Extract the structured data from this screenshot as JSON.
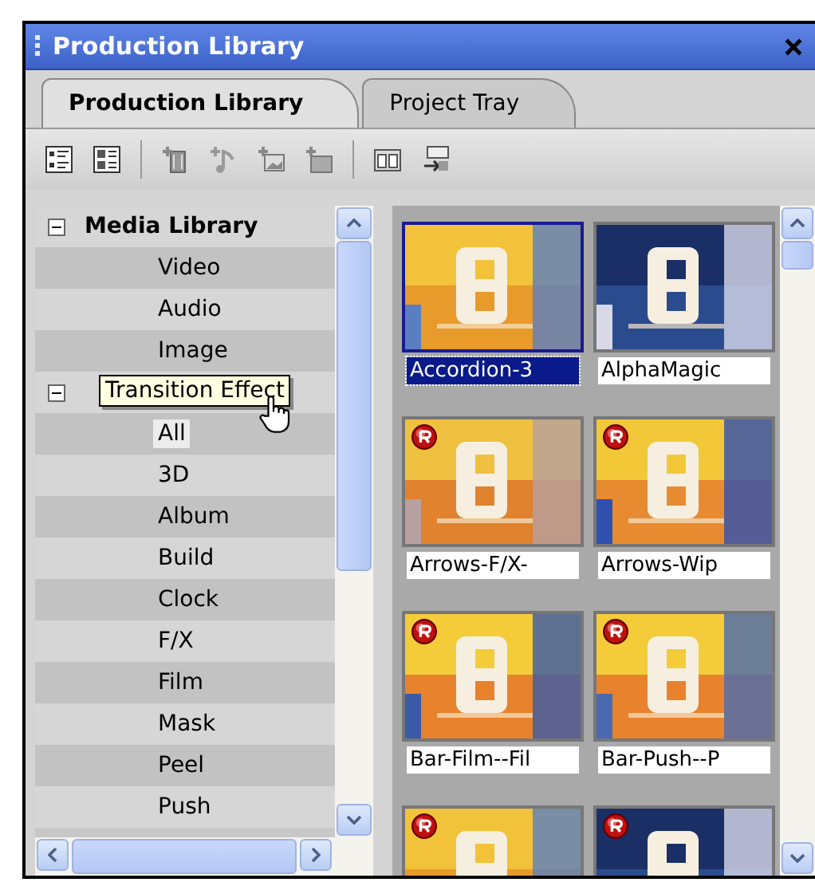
{
  "window": {
    "title": "Production Library"
  },
  "tabs": [
    {
      "label": "Production Library",
      "selected": true
    },
    {
      "label": "Project Tray",
      "selected": false
    }
  ],
  "tree": [
    {
      "label": "Media Library",
      "expanded": true,
      "children": [
        {
          "label": "Video",
          "selected": false
        },
        {
          "label": "Audio",
          "selected": false
        },
        {
          "label": "Image",
          "selected": false
        }
      ]
    },
    {
      "tooltip": "Transition Effect",
      "expanded": true,
      "children": [
        {
          "label": "All",
          "selected": true
        },
        {
          "label": "3D",
          "selected": false
        },
        {
          "label": "Album",
          "selected": false
        },
        {
          "label": "Build",
          "selected": false
        },
        {
          "label": "Clock",
          "selected": false
        },
        {
          "label": "F/X",
          "selected": false
        },
        {
          "label": "Film",
          "selected": false
        },
        {
          "label": "Mask",
          "selected": false
        },
        {
          "label": "Peel",
          "selected": false
        },
        {
          "label": "Push",
          "selected": false
        }
      ]
    }
  ],
  "items": [
    {
      "label": "Accordion-3",
      "selected": true,
      "badge": false
    },
    {
      "label": "AlphaMagic",
      "selected": false,
      "badge": false
    },
    {
      "label": "Arrows-F/X-",
      "selected": false,
      "badge": true
    },
    {
      "label": "Arrows-Wip",
      "selected": false,
      "badge": true
    },
    {
      "label": "Bar-Film--Fil",
      "selected": false,
      "badge": true
    },
    {
      "label": "Bar-Push--P",
      "selected": false,
      "badge": true
    },
    {
      "selected": false,
      "badge": true
    },
    {
      "selected": false,
      "badge": true
    }
  ]
}
